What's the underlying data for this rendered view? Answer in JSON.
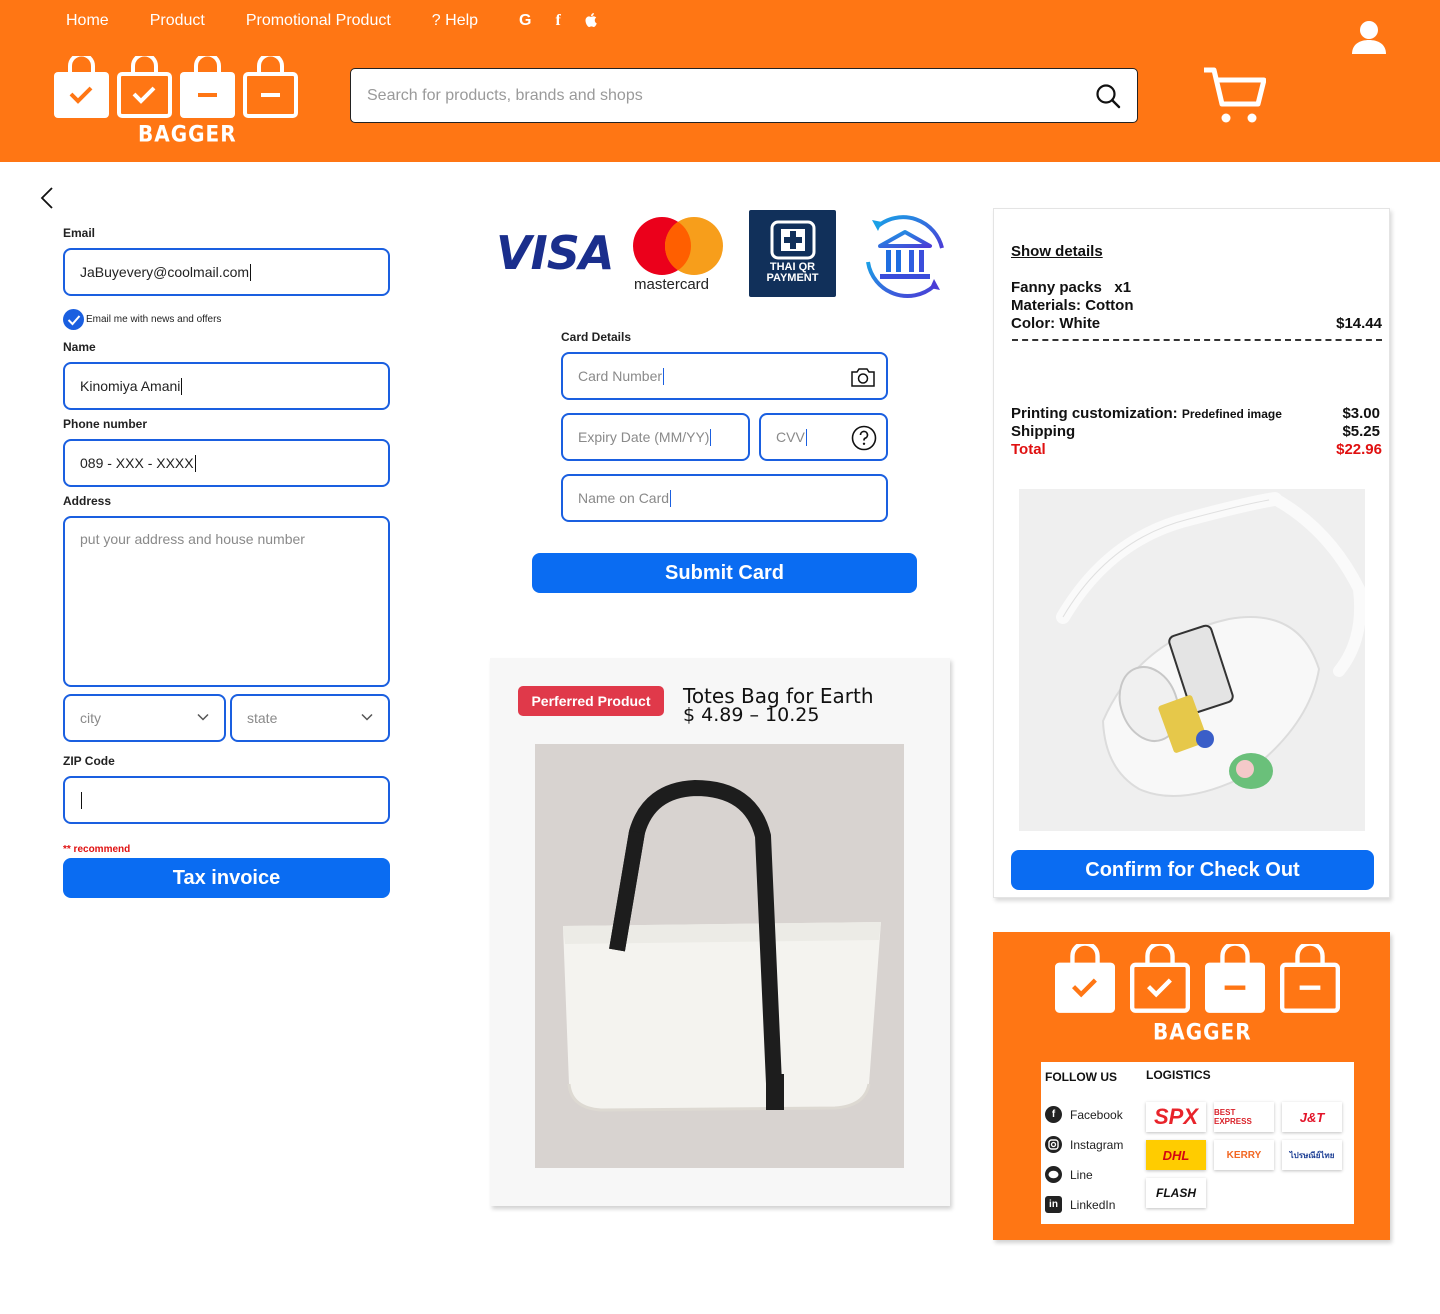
{
  "nav": {
    "home": "Home",
    "product": "Product",
    "promotional": "Promotional Product",
    "help": "? Help",
    "social_google": "G",
    "social_facebook": "f"
  },
  "brand": {
    "name": "BAGGER"
  },
  "search": {
    "placeholder": "Search for products, brands and shops"
  },
  "form": {
    "email_label": "Email",
    "email_value": "JaBuyevery@coolmail.com",
    "news_label": "Email me with news and offers",
    "name_label": "Name",
    "name_value": "Kinomiya Amani",
    "phone_label": "Phone number",
    "phone_value": "089 - XXX - XXXX",
    "address_label": "Address",
    "address_placeholder": "put your address and house number",
    "city_placeholder": "city",
    "state_placeholder": "state",
    "zip_label": "ZIP Code",
    "zip_value": "",
    "recommend": "** recommend",
    "tax_button": "Tax invoice"
  },
  "payment": {
    "visa": "VISA",
    "mastercard": "mastercard",
    "qr_line1": "THAI QR",
    "qr_line2": "PAYMENT",
    "card_details_label": "Card Details",
    "card_number_placeholder": "Card Number",
    "expiry_placeholder": "Expiry Date (MM/YY)",
    "cvv_placeholder": "CVV",
    "name_on_card_placeholder": "Name on Card",
    "submit_button": "Submit Card"
  },
  "product": {
    "badge": "Perferred Product",
    "title": "Totes Bag for Earth",
    "price": "$ 4.89 – 10.25"
  },
  "summary": {
    "show_details": "Show details",
    "item_name": "Fanny packs   x1",
    "materials": "Materials: Cotton",
    "color": "Color: White",
    "item_price": "$14.44",
    "printing_label": "Printing customization:",
    "printing_option": "Predefined image",
    "printing_price": "$3.00",
    "shipping_label": "Shipping",
    "shipping_price": "$5.25",
    "total_label": "Total",
    "total_price": "$22.96",
    "confirm_button": "Confirm for Check Out"
  },
  "footer": {
    "brand": "BAGGER",
    "follow_us": "FOLLOW US",
    "logistics": "LOGISTICS",
    "links": [
      "Facebook",
      "Instagram",
      "Line",
      "LinkedIn"
    ],
    "carriers": [
      "SPX",
      "BEST EXPRESS",
      "J&T",
      "DHL",
      "KERRY",
      "ไปรษณีย์ไทย",
      "FLASH"
    ]
  },
  "colors": {
    "brand_orange": "#ff7614",
    "primary_blue": "#0a6cf2",
    "total_red": "#e01010",
    "badge_red": "#e0394a"
  }
}
